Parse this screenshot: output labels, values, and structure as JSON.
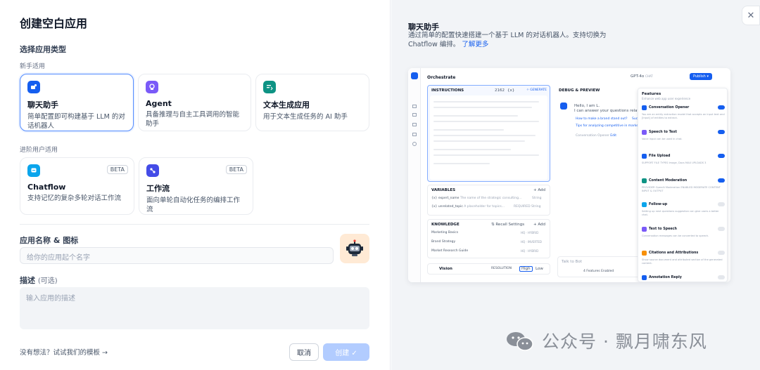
{
  "dialog": {
    "title": "创建空白应用",
    "app_type_heading": "选择应用类型",
    "beginner_label": "新手适用",
    "advanced_label": "进阶用户适用",
    "beginner_types": [
      {
        "name": "聊天助手",
        "desc": "简单配置即可构建基于 LLM 的对话机器人",
        "icon": "chat-bot-icon",
        "color": "#155eef"
      },
      {
        "name": "Agent",
        "desc": "具备推理与自主工具调用的智能助手",
        "icon": "agent-icon",
        "color": "#7a5af8"
      },
      {
        "name": "文本生成应用",
        "desc": "用于文本生成任务的 AI 助手",
        "icon": "text-generation-icon",
        "color": "#0e9384"
      }
    ],
    "advanced_types": [
      {
        "name": "Chatflow",
        "desc": "支持记忆的复杂多轮对话工作流",
        "badge": "BETA",
        "icon": "chatflow-icon",
        "color": "#0ba5ec"
      },
      {
        "name": "工作流",
        "desc": "面向单轮自动化任务的编排工作流",
        "badge": "BETA",
        "icon": "workflow-icon",
        "color": "#444ce7"
      }
    ],
    "name_icon_label": "应用名称 & 图标",
    "name_placeholder": "给你的应用起个名字",
    "desc_label": "描述",
    "desc_optional": "(可选)",
    "desc_placeholder": "输入应用的描述",
    "template_link": "没有想法？试试我们的模板 →",
    "cancel_label": "取消",
    "create_label": "创建 ✓"
  },
  "preview_panel": {
    "title": "聊天助手",
    "desc": "通过简单的配置快速搭建一个基于 LLM 的对话机器人。支持切换为 Chatflow 编排。",
    "learn_more": "了解更多",
    "close_icon": "close-icon"
  },
  "preview": {
    "orchestrate": "Orchestrate",
    "model": "GPT-4o",
    "model_tag": "CHAT",
    "publish": "Publish ▾",
    "instructions": "INSTRUCTIONS",
    "instructions_count": "2162",
    "instructions_var": "{x}",
    "generate": "✧ GENERATE",
    "variables": "VARIABLES",
    "add": "+ Add",
    "variable_rows": [
      {
        "key": "{x} expert_name",
        "desc": "The name of the strategic consulting...",
        "type": "String"
      },
      {
        "key": "{x} unrelated_topic",
        "desc": "A placeholder for topics...",
        "type": "REQUIRED  String"
      }
    ],
    "knowledge": "KNOWLEDGE",
    "recall": "⇅ Recall Settings",
    "knowledge_rows": [
      {
        "name": "Marketing Basics",
        "tags": "HQ · HYBRID"
      },
      {
        "name": "Brand Strategy",
        "tags": "HQ · INVERTED"
      },
      {
        "name": "Market Research Guide",
        "tags": "HQ · HYBRID"
      }
    ],
    "vision": "Vision",
    "resolution": "RESOLUTION",
    "res_high": "High",
    "res_low": "Low",
    "debug": "DEBUG & PREVIEW",
    "hello": "Hello, I am L.",
    "hello2": "I can answer your questions related",
    "suggest1": "How to make a brand stand out?",
    "suggest1b": "Suc",
    "suggest2": "Tips for analyzing competitive in marke",
    "opener": "Conversation Opener",
    "edit": "Edit",
    "talk": "Talk to Bot",
    "features_enabled": "4 Features Enabled",
    "features": "Features",
    "features_sub": "Enhance web app user experience",
    "feature_list": [
      {
        "name": "Conversation Opener",
        "desc": "You are an entity extraction model that accepts an input text and [Input] of entities to extract.",
        "on": true,
        "color": "#155eef"
      },
      {
        "name": "Speech to Text",
        "desc": "Voice input can be used in chat.",
        "on": true,
        "color": "#7a5af8"
      },
      {
        "name": "File Upload",
        "desc": "SUPPORT FILE TYPES  Image, Docs     MAX UPLOADS  3",
        "on": true,
        "color": "#155eef"
      },
      {
        "name": "Content Moderation",
        "desc": "PROVIDER  OpenAI Moderation   ENABLED MODERATE CONTENT  INPUT & OUTPUT",
        "on": true,
        "color": "#0e9384"
      },
      {
        "name": "Follow-up",
        "desc": "Setting up next questions suggestion can give users a better chat.",
        "on": false,
        "color": "#0ba5ec"
      },
      {
        "name": "Text to Speech",
        "desc": "Conversation messages can be converted to speech.",
        "on": false,
        "color": "#7a5af8"
      },
      {
        "name": "Citations and Attributions",
        "desc": "Show source document and attributed section of the generated content.",
        "on": false,
        "color": "#f79009"
      },
      {
        "name": "Annotation Reply",
        "desc": "",
        "on": false,
        "color": "#155eef"
      }
    ]
  },
  "watermark": "公众号 · 飘月啸东风"
}
